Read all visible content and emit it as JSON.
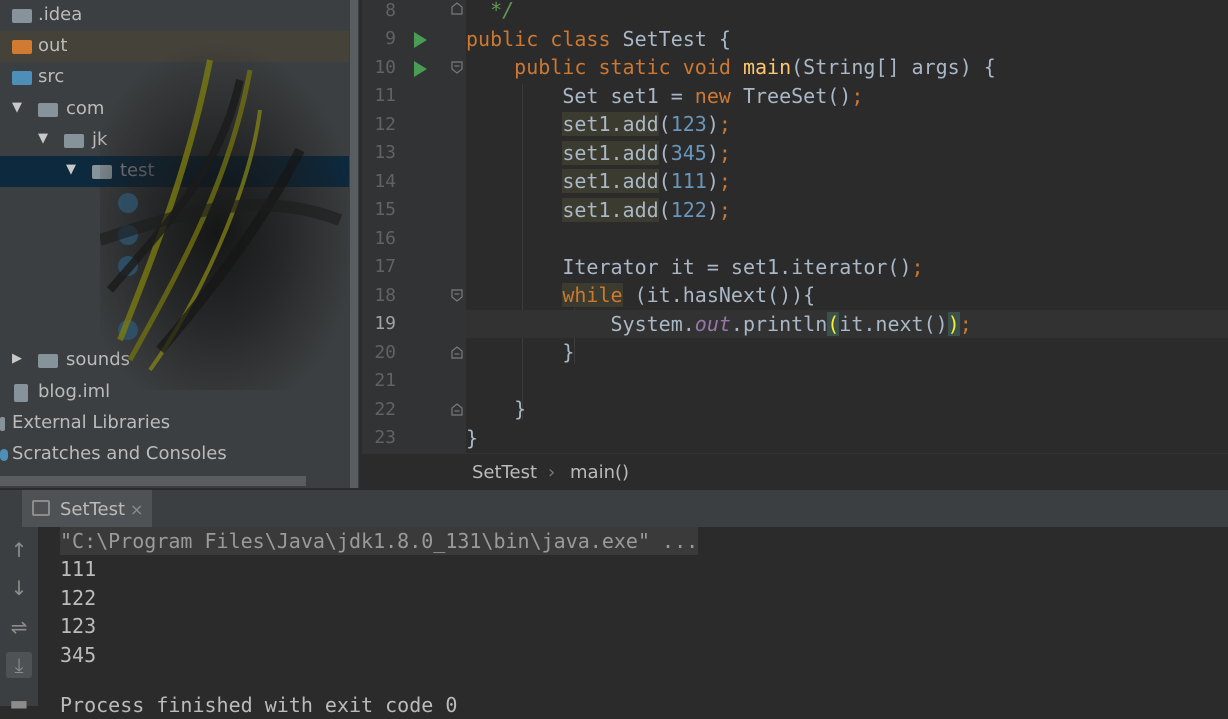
{
  "project_tree": [
    {
      "label": ".idea",
      "icon": "folder-icon",
      "color": "#87939a",
      "indent": 0,
      "arrow": ""
    },
    {
      "label": "out",
      "icon": "folder-icon",
      "color": "#d07a32",
      "indent": 0,
      "arrow": ""
    },
    {
      "label": "src",
      "icon": "folder-icon",
      "color": "#4d8fb8",
      "indent": 0,
      "arrow": ""
    },
    {
      "label": "com",
      "icon": "package-icon",
      "color": "#87939a",
      "indent": 1,
      "arrow": "▼"
    },
    {
      "label": "jk",
      "icon": "package-icon",
      "color": "#87939a",
      "indent": 2,
      "arrow": "▼"
    },
    {
      "label": "test",
      "icon": "package-icon",
      "color": "#87939a",
      "indent": 3,
      "arrow": "▼"
    },
    {
      "label": "sounds",
      "icon": "package-icon",
      "color": "#87939a",
      "indent": 1,
      "arrow": "▶"
    },
    {
      "label": "blog.iml",
      "icon": "file-icon",
      "color": "#87939a",
      "indent": 0,
      "arrow": ""
    },
    {
      "label": "External Libraries",
      "icon": "library-icon",
      "color": "#87939a",
      "indent": -1,
      "arrow": ""
    },
    {
      "label": "Scratches and Consoles",
      "icon": "scratch-icon",
      "color": "#4d8fb8",
      "indent": -1,
      "arrow": ""
    }
  ],
  "editor": {
    "line_numbers": [
      "8",
      "9",
      "10",
      "11",
      "12",
      "13",
      "14",
      "15",
      "16",
      "17",
      "18",
      "19",
      "20",
      "21",
      "22",
      "23"
    ],
    "current_line": "19"
  },
  "breadcrumb": {
    "class_name": "SetTest",
    "method_name": "main()",
    "separator": "›"
  },
  "run_panel": {
    "tab_label": "SetTest",
    "close_glyph": "×",
    "command": "\"C:\\Program Files\\Java\\jdk1.8.0_131\\bin\\java.exe\" ...",
    "output": [
      "111",
      "122",
      "123",
      "345"
    ],
    "finish_text": "Process finished with exit code 0"
  }
}
